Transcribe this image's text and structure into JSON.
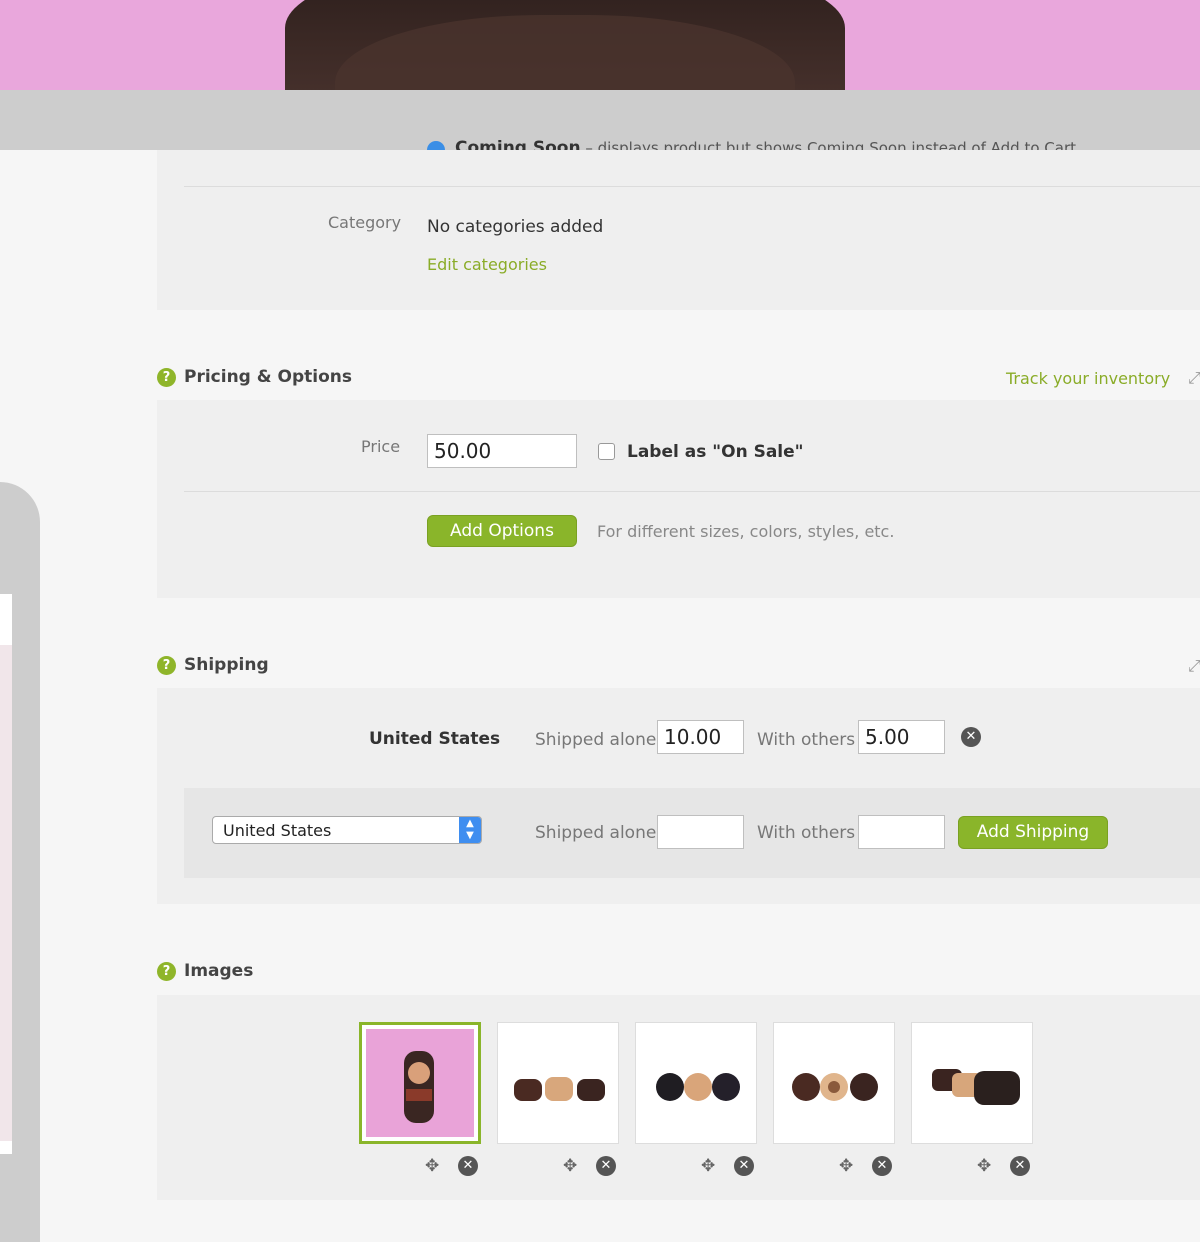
{
  "status_section": {
    "coming_soon_label": "Coming Soon",
    "coming_soon_desc": " – displays product but shows Coming Soon instead of Add to Cart"
  },
  "category": {
    "label": "Category",
    "value": "No categories added",
    "edit_link": "Edit categories"
  },
  "pricing": {
    "title": "Pricing & Options",
    "track_link": "Track your inventory",
    "price_label": "Price",
    "price_value": "50.00",
    "on_sale_label": "Label as \"On Sale\"",
    "add_options_label": "Add Options",
    "options_hint": "For different sizes, colors, styles, etc."
  },
  "shipping": {
    "title": "Shipping",
    "row1": {
      "country": "United States",
      "alone_label": "Shipped alone",
      "alone_value": "10.00",
      "others_label": "With others",
      "others_value": "5.00"
    },
    "row2": {
      "country_select": "United States",
      "alone_label": "Shipped alone",
      "alone_value": "",
      "others_label": "With others",
      "others_value": "",
      "add_button": "Add Shipping"
    }
  },
  "images": {
    "title": "Images",
    "thumbnails": [
      {
        "name": "image-1",
        "active": true
      },
      {
        "name": "image-2",
        "active": false
      },
      {
        "name": "image-3",
        "active": false
      },
      {
        "name": "image-4",
        "active": false
      },
      {
        "name": "image-5",
        "active": false
      }
    ]
  },
  "icons": {
    "help": "question-circle-icon",
    "remove": "close-circle-icon",
    "move": "move-icon",
    "expand": "expand-icon"
  },
  "colors": {
    "accent": "#8ab52a",
    "select_arrow": "#3f8ef0",
    "hero_bg": "#e9a7dc"
  }
}
